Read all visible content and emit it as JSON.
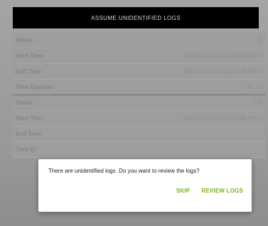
{
  "header": {
    "title": "ASSUME UNIDENTIFIED LOGS"
  },
  "logs": [
    {
      "status_label": "Status",
      "status_value": "D",
      "start_label": "Start Time",
      "start_value": "2020-01-14 11:51:48 AM (PST)",
      "end_label": "End Time",
      "end_value": "2020-01-14 11:53:23 AM (PST)",
      "elapsed_label": "Time Elapsed",
      "elapsed_value": "0h 1m"
    },
    {
      "status_label": "Status",
      "status_value": "ON",
      "start_label": "Start Time",
      "start_value": "2020-01-14 11:53:23 AM (PST)",
      "end_label": "End Time",
      "end_value": "",
      "elapsed_label": "Time El",
      "elapsed_value": ""
    }
  ],
  "dialog": {
    "message": "There are unidentified logs. Do you want to review the logs?",
    "skip_label": "SKIP",
    "review_label": "REVIEW LOGS",
    "accent_color": "#7ab01e"
  }
}
